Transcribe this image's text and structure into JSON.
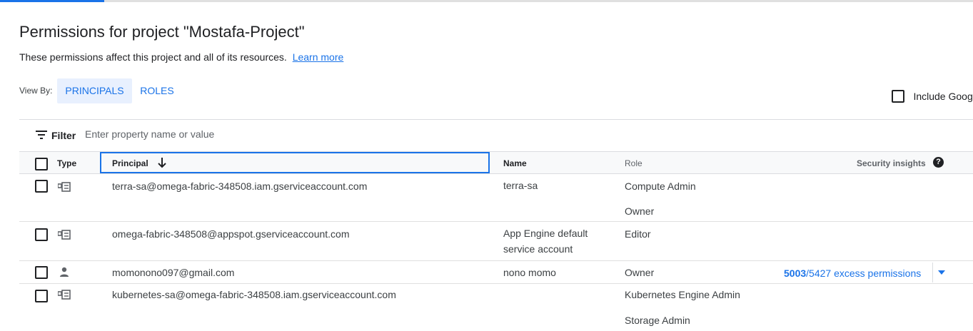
{
  "page": {
    "title": "Permissions for project \"Mostafa-Project\"",
    "description": "These permissions affect this project and all of its resources.",
    "learn_more": "Learn more"
  },
  "view_by": {
    "label": "View By:",
    "tabs": [
      {
        "label": "PRINCIPALS",
        "selected": true
      },
      {
        "label": "ROLES",
        "selected": false
      }
    ]
  },
  "include_google": {
    "label": "Include Googl",
    "checked": false
  },
  "filter": {
    "label": "Filter",
    "placeholder": "Enter property name or value"
  },
  "table": {
    "columns": {
      "type": "Type",
      "principal": "Principal",
      "name": "Name",
      "role": "Role",
      "security_insights": "Security insights"
    },
    "help_glyph": "?",
    "sort": {
      "column": "principal",
      "direction": "descending-arrow"
    },
    "rows": [
      {
        "type_icon": "service-account-icon",
        "principal": "terra-sa@omega-fabric-348508.iam.gserviceaccount.com",
        "name": "terra-sa",
        "roles": [
          "Compute Admin",
          "Owner"
        ],
        "insight": null
      },
      {
        "type_icon": "service-account-icon",
        "principal": "omega-fabric-348508@appspot.gserviceaccount.com",
        "name": "App Engine default service account",
        "roles": [
          "Editor"
        ],
        "insight": null
      },
      {
        "type_icon": "person-icon",
        "principal": "momonono097@gmail.com",
        "name": "nono momo",
        "roles": [
          "Owner"
        ],
        "insight": {
          "excess": "5003",
          "total": "/5427",
          "text": " excess permissions"
        }
      },
      {
        "type_icon": "service-account-icon",
        "principal": "kubernetes-sa@omega-fabric-348508.iam.gserviceaccount.com",
        "name": "",
        "roles": [
          "Kubernetes Engine Admin",
          "Storage Admin"
        ],
        "insight": null
      }
    ]
  },
  "colors": {
    "accent": "#1a73e8",
    "selected_tab_bg": "#e8f0fe",
    "header_bg": "#f8f9fa"
  }
}
